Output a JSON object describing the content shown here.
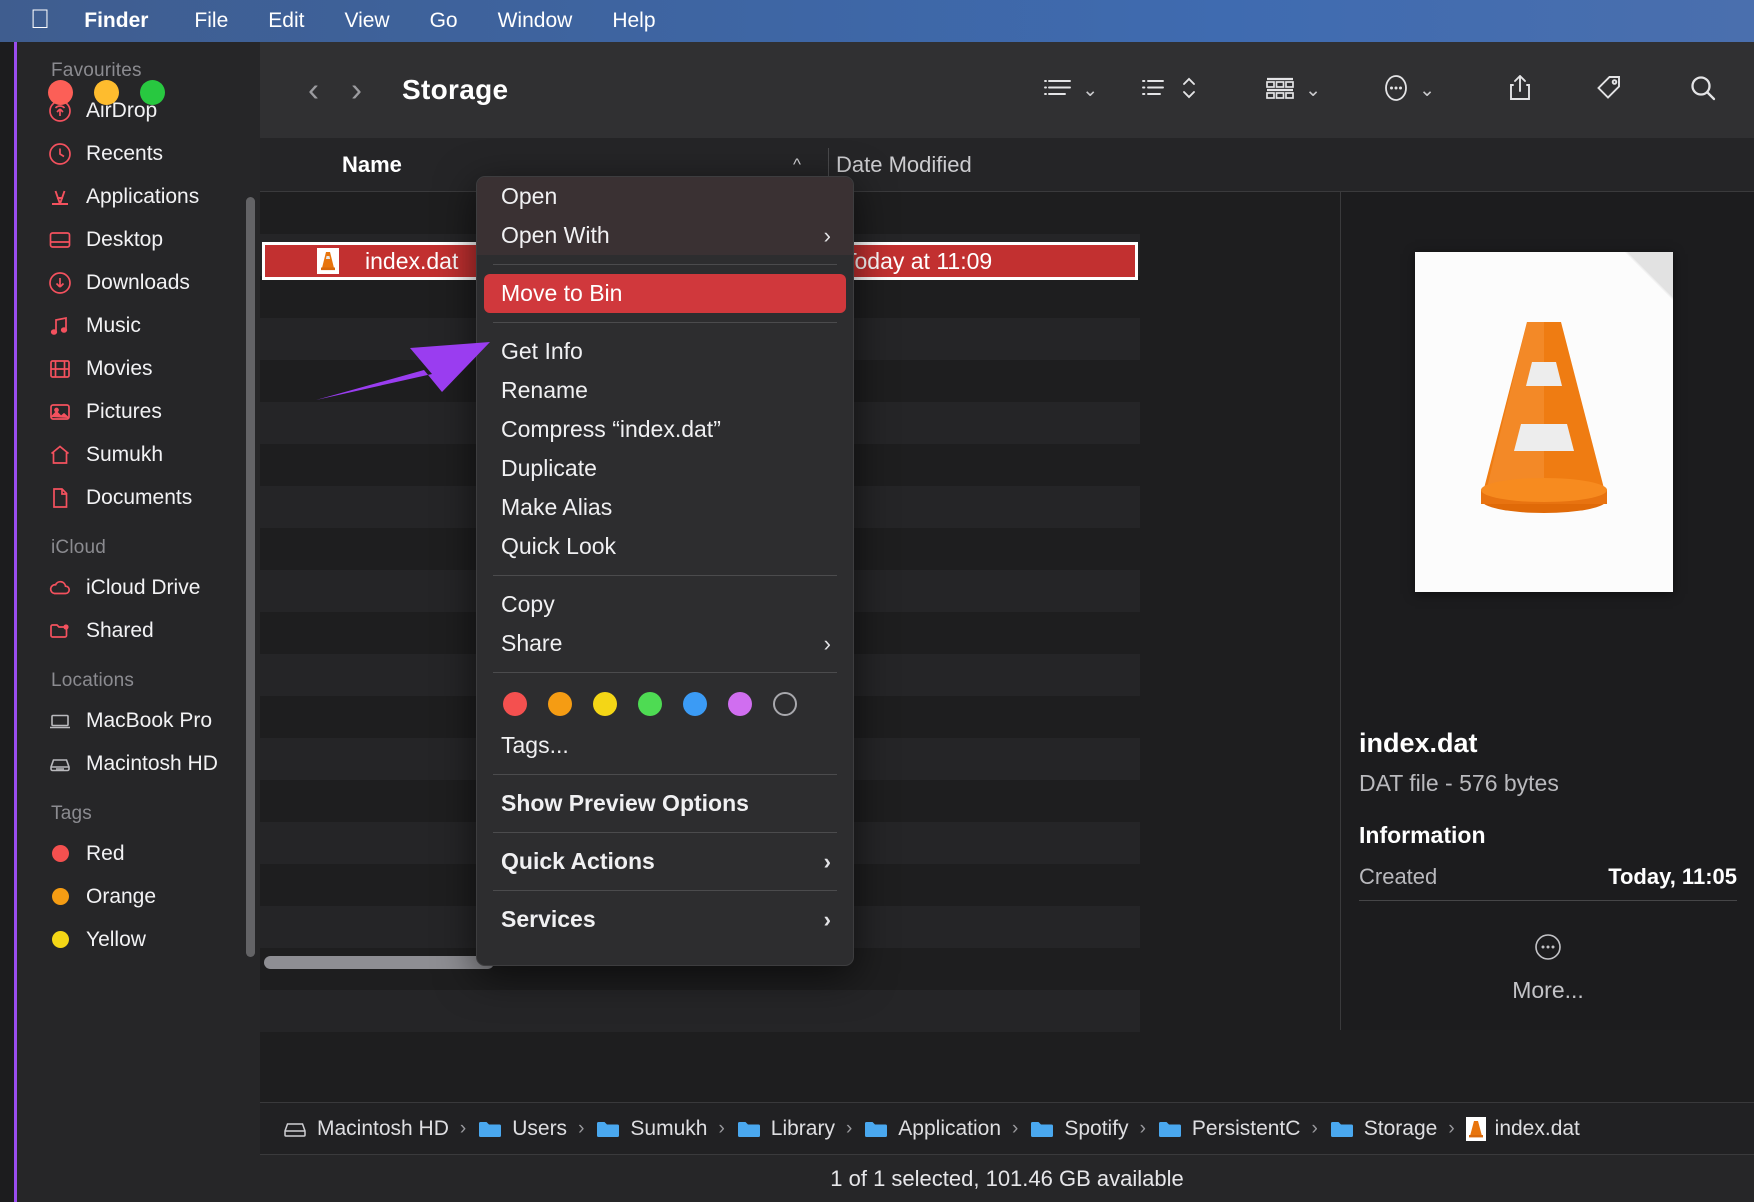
{
  "menubar": {
    "apple_icon": "apple-logo",
    "items": [
      {
        "label": "Finder",
        "bold": true
      },
      {
        "label": "File",
        "bold": false
      },
      {
        "label": "Edit",
        "bold": false
      },
      {
        "label": "View",
        "bold": false
      },
      {
        "label": "Go",
        "bold": false
      },
      {
        "label": "Window",
        "bold": false
      },
      {
        "label": "Help",
        "bold": false
      }
    ]
  },
  "window": {
    "title": "Storage",
    "traffic_lights": [
      "close",
      "minimize",
      "zoom"
    ],
    "back_icon": "chevron-left-icon",
    "forward_icon": "chevron-right-icon",
    "toolbar_buttons": [
      {
        "name": "view-options",
        "icon": "list-view-icon"
      },
      {
        "name": "group-sort",
        "icon": "sort-list-icon"
      },
      {
        "name": "item-arrange",
        "icon": "grid-group-icon"
      },
      {
        "name": "action-menu",
        "icon": "ellipsis-circle-icon"
      },
      {
        "name": "share",
        "icon": "share-icon"
      },
      {
        "name": "tags",
        "icon": "tag-icon"
      },
      {
        "name": "search",
        "icon": "search-icon"
      }
    ]
  },
  "sidebar": {
    "sections": [
      {
        "title": "Favourites",
        "items": [
          {
            "label": "AirDrop",
            "icon": "airdrop-icon",
            "color": "#f4515e"
          },
          {
            "label": "Recents",
            "icon": "clock-icon",
            "color": "#f4515e"
          },
          {
            "label": "Applications",
            "icon": "applications-icon",
            "color": "#f4515e"
          },
          {
            "label": "Desktop",
            "icon": "desktop-icon",
            "color": "#f4515e"
          },
          {
            "label": "Downloads",
            "icon": "download-circle-icon",
            "color": "#f4515e"
          },
          {
            "label": "Music",
            "icon": "music-note-icon",
            "color": "#f4515e"
          },
          {
            "label": "Movies",
            "icon": "film-icon",
            "color": "#f4515e"
          },
          {
            "label": "Pictures",
            "icon": "photo-icon",
            "color": "#f4515e"
          },
          {
            "label": "Sumukh",
            "icon": "home-icon",
            "color": "#f4515e"
          },
          {
            "label": "Documents",
            "icon": "document-icon",
            "color": "#f4515e"
          }
        ]
      },
      {
        "title": "iCloud",
        "items": [
          {
            "label": "iCloud Drive",
            "icon": "cloud-icon",
            "color": "#f4515e"
          },
          {
            "label": "Shared",
            "icon": "shared-folder-icon",
            "color": "#f4515e"
          }
        ]
      },
      {
        "title": "Locations",
        "items": [
          {
            "label": "MacBook Pro",
            "icon": "laptop-icon",
            "color": "#b9b9bd"
          },
          {
            "label": "Macintosh HD",
            "icon": "harddisk-icon",
            "color": "#b9b9bd"
          }
        ]
      },
      {
        "title": "Tags",
        "items": [
          {
            "label": "Red",
            "icon": "tag-dot-icon",
            "color": "#f4504f"
          },
          {
            "label": "Orange",
            "icon": "tag-dot-icon",
            "color": "#f59c13"
          },
          {
            "label": "Yellow",
            "icon": "tag-dot-icon",
            "color": "#f4d616"
          }
        ]
      }
    ]
  },
  "filelist": {
    "columns": [
      {
        "label": "Name",
        "sorted": true,
        "sort_icon": "chevron-up-icon"
      },
      {
        "label": "Date Modified",
        "sorted": false
      }
    ],
    "selected_row": {
      "name": "index.dat",
      "date_modified": "Today at 11:09",
      "icon": "vlc-cone-icon"
    }
  },
  "context_menu": {
    "items": [
      {
        "label": "Open",
        "submenu": false,
        "highlighted": false,
        "bold": false,
        "section": 0
      },
      {
        "label": "Open With",
        "submenu": true,
        "highlighted": false,
        "bold": false,
        "section": 0
      },
      {
        "label": "Move to Bin",
        "submenu": false,
        "highlighted": true,
        "bold": false,
        "section": 1
      },
      {
        "label": "Get Info",
        "submenu": false,
        "highlighted": false,
        "bold": false,
        "section": 2
      },
      {
        "label": "Rename",
        "submenu": false,
        "highlighted": false,
        "bold": false,
        "section": 2
      },
      {
        "label": "Compress “index.dat”",
        "submenu": false,
        "highlighted": false,
        "bold": false,
        "section": 2
      },
      {
        "label": "Duplicate",
        "submenu": false,
        "highlighted": false,
        "bold": false,
        "section": 2
      },
      {
        "label": "Make Alias",
        "submenu": false,
        "highlighted": false,
        "bold": false,
        "section": 2
      },
      {
        "label": "Quick Look",
        "submenu": false,
        "highlighted": false,
        "bold": false,
        "section": 2
      },
      {
        "label": "Copy",
        "submenu": false,
        "highlighted": false,
        "bold": false,
        "section": 3
      },
      {
        "label": "Share",
        "submenu": true,
        "highlighted": false,
        "bold": false,
        "section": 3
      },
      {
        "label": "Tags...",
        "submenu": false,
        "highlighted": false,
        "bold": false,
        "section": 4
      },
      {
        "label": "Show Preview Options",
        "submenu": false,
        "highlighted": false,
        "bold": true,
        "section": 5
      },
      {
        "label": "Quick Actions",
        "submenu": true,
        "highlighted": false,
        "bold": true,
        "section": 6
      },
      {
        "label": "Services",
        "submenu": true,
        "highlighted": false,
        "bold": true,
        "section": 7
      }
    ],
    "tag_swatches": [
      "#f4504f",
      "#f59c13",
      "#f4d616",
      "#4edb53",
      "#3b9bf5",
      "#d06ef0",
      "none"
    ],
    "submenu_glyph": "›",
    "highlight_color": "#d0383c"
  },
  "preview": {
    "file_icon": "vlc-cone-icon",
    "name": "index.dat",
    "kind_size": "DAT file - 576 bytes",
    "info_header": "Information",
    "created_label": "Created",
    "created_value": "Today, 11:05",
    "more_label": "More...",
    "more_icon": "ellipsis-circle-icon"
  },
  "pathbar": {
    "crumbs": [
      {
        "label": "Macintosh HD",
        "icon": "harddisk-icon"
      },
      {
        "label": "Users",
        "icon": "folder-icon"
      },
      {
        "label": "Sumukh",
        "icon": "home-folder-icon"
      },
      {
        "label": "Library",
        "icon": "folder-icon"
      },
      {
        "label": "Application",
        "icon": "folder-icon"
      },
      {
        "label": "Spotify",
        "icon": "folder-icon"
      },
      {
        "label": "PersistentC",
        "icon": "folder-icon"
      },
      {
        "label": "Storage",
        "icon": "folder-icon"
      },
      {
        "label": "index.dat",
        "icon": "vlc-cone-icon"
      }
    ],
    "separator": "›"
  },
  "statusbar": {
    "text": "1 of 1 selected, 101.46 GB available"
  },
  "annotation": {
    "arrow_color": "#9a3df0",
    "points_to": "Move to Bin"
  }
}
